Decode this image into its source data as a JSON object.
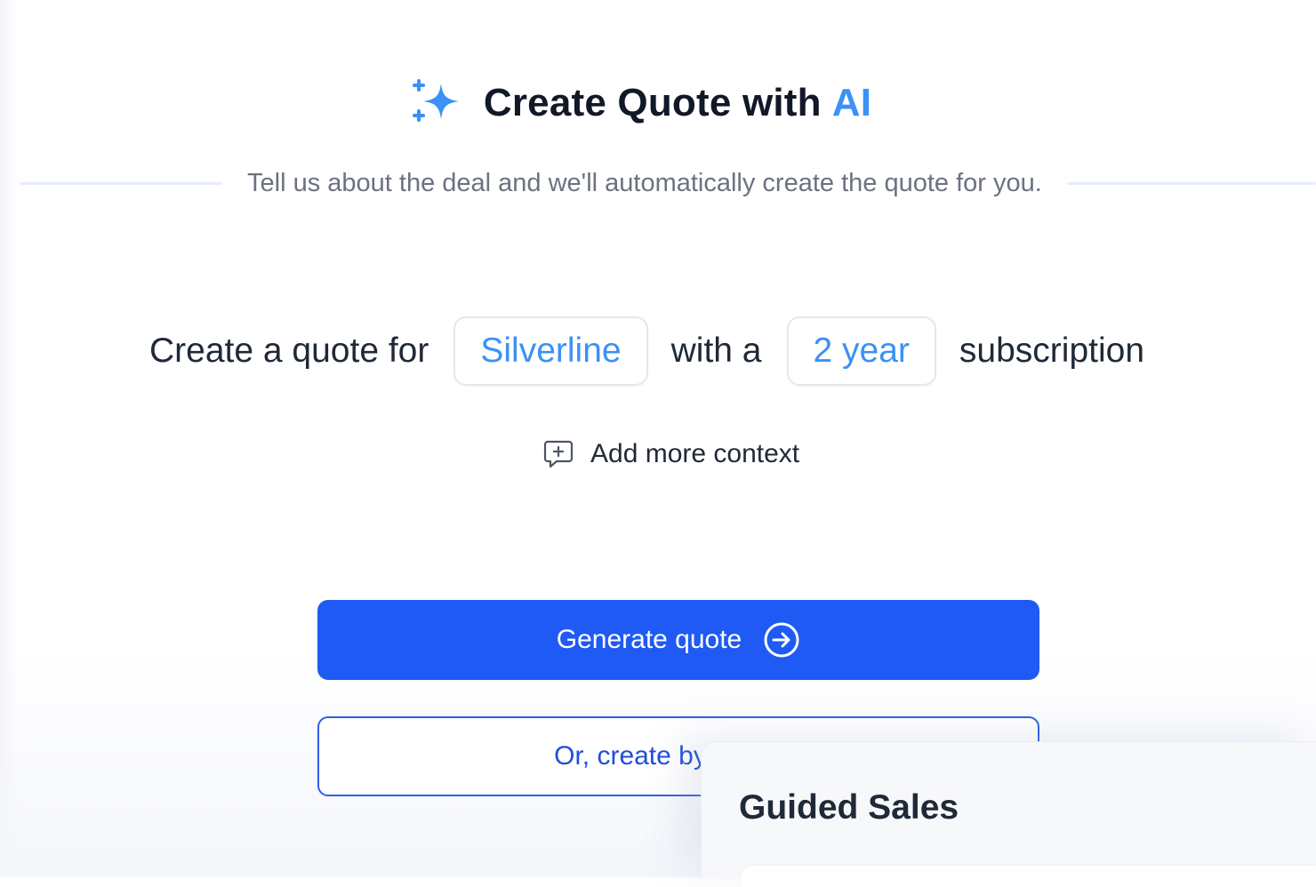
{
  "header": {
    "icon": "sparkle-icon",
    "title": "Create Quote with",
    "title_accent": "AI",
    "subtitle": "Tell us about the deal and we'll automatically create the quote for you."
  },
  "prompt": {
    "prefix": "Create a quote for",
    "company_value": "Silverline",
    "middle": "with a",
    "term_value": "2 year",
    "suffix": "subscription"
  },
  "context": {
    "icon": "add-comment-icon",
    "label": "Add more context"
  },
  "actions": {
    "generate_label": "Generate quote",
    "generate_icon": "arrow-right-circle-icon",
    "manual_label": "Or, create by fillin"
  },
  "overlay": {
    "title": "Guided Sales"
  },
  "colors": {
    "accent": "#3b91f5",
    "primary": "#1f5af5",
    "text": "#1f2937",
    "muted": "#6b7280"
  }
}
